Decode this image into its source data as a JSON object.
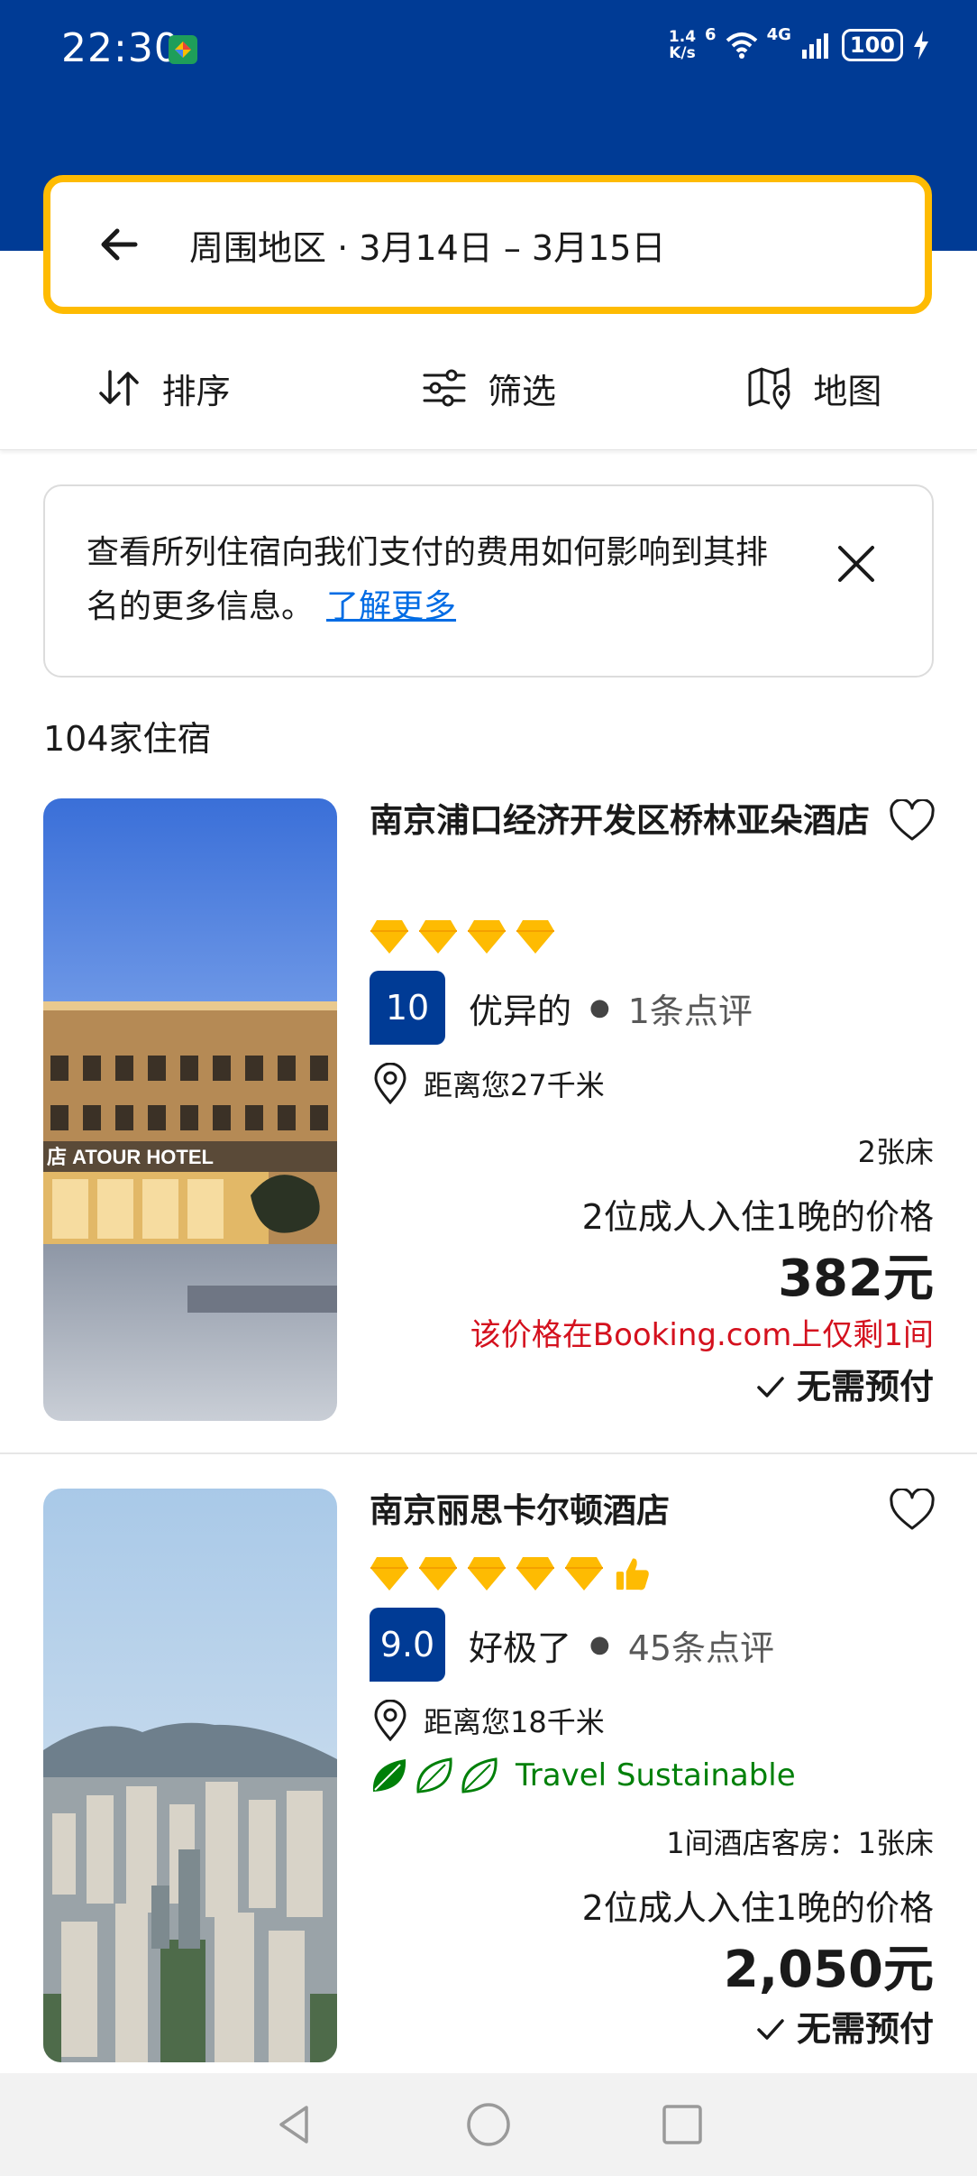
{
  "status_bar": {
    "time": "22:30",
    "net_speed_value": "1.4",
    "net_speed_unit": "K/s",
    "wifi_label": "6",
    "cell_label": "4G",
    "battery": "100"
  },
  "search": {
    "text": "周围地区 · 3月14日 – 3月15日"
  },
  "toolbar": {
    "sort_label": "排序",
    "filter_label": "筛选",
    "map_label": "地图"
  },
  "notice": {
    "text": "查看所列住宿向我们支付的费用如何影响到其排名的更多信息。",
    "link": "了解更多"
  },
  "results": {
    "count": "104家住宿"
  },
  "hotels": [
    {
      "name": "南京浦口经济开发区桥林亚朵酒店",
      "gem_rating": 4,
      "score": "10",
      "score_word": "优异的",
      "reviews": "1条点评",
      "distance": "距离您27千米",
      "beds": "2张床",
      "price_label": "2位成人入住1晚的价格",
      "price": "382元",
      "scarcity": "该价格在Booking.com上仅剩1间",
      "no_prepay": "无需预付",
      "image_sign": "店 ATOUR HOTEL"
    },
    {
      "name": "南京丽思卡尔顿酒店",
      "gem_rating": 5,
      "score": "9.0",
      "score_word": "好极了",
      "reviews": "45条点评",
      "distance": "距离您18千米",
      "sustainable": "Travel Sustainable",
      "beds": "1间酒店客房：1张床",
      "price_label": "2位成人入住1晚的价格",
      "price": "2,050元",
      "no_prepay": "无需预付"
    }
  ],
  "colors": {
    "brand_blue": "#003b95",
    "search_border": "#febb02",
    "link_blue": "#006ce4",
    "gem_yellow": "#febb02",
    "warning_red": "#d4111e",
    "sustain_green": "#008009"
  }
}
